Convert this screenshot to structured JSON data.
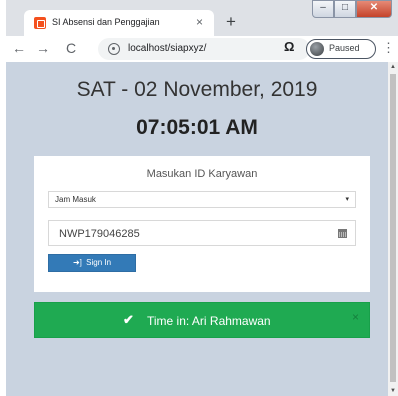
{
  "browser": {
    "tab_title": "SI Absensi dan Penggajian",
    "tab_close": "×",
    "new_tab": "+",
    "window_controls": {
      "minimize": "–",
      "maximize": "□",
      "close": "✕"
    },
    "nav": {
      "back": "←",
      "forward": "→",
      "reload": "C"
    },
    "url": "localhost/siapxyz/",
    "extension_icon": "Ω",
    "profile_status": "Paused",
    "menu": "⋮"
  },
  "clock": {
    "date": "SAT - 02 November, 2019",
    "time": "07:05:01 AM"
  },
  "form": {
    "title": "Masukan ID Karyawan",
    "select_value": "Jam Masuk",
    "select_arrow": "▾",
    "employee_id": "NWP179046285",
    "signin_icon": "➜]",
    "signin_label": "Sign In"
  },
  "alert": {
    "check": "✔",
    "message": "Time in: Ari Rahmawan",
    "close": "×"
  },
  "colors": {
    "page_background": "#c9d3e0",
    "success": "#1faa52",
    "primary": "#337ab7"
  }
}
